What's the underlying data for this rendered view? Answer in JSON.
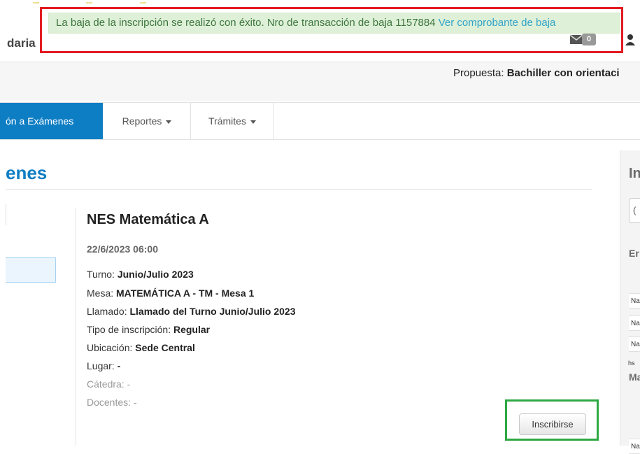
{
  "header": {
    "brand": "daria",
    "mail_count": "0",
    "propuesta_label": "Propuesta:",
    "propuesta_value": "Bachiller con orientaci"
  },
  "nav": {
    "items": [
      {
        "label": "ón a Exámenes",
        "active": true
      },
      {
        "label": "Reportes"
      },
      {
        "label": "Trámites"
      }
    ]
  },
  "main": {
    "page_title": "enes"
  },
  "exam": {
    "title": "NES Matemática A",
    "date": "22/6/2023 06:00",
    "fields": [
      {
        "label": "Turno:",
        "value": "Junio/Julio 2023"
      },
      {
        "label": "Mesa:",
        "value": "MATEMÁTICA A - TM - Mesa 1"
      },
      {
        "label": "Llamado:",
        "value": "Llamado del Turno Junio/Julio 2023"
      },
      {
        "label": "Tipo de inscripción:",
        "value": "Regular"
      },
      {
        "label": "Ubicación:",
        "value": "Sede Central"
      },
      {
        "label": "Lugar:",
        "value": "-"
      },
      {
        "label": "Cátedra:",
        "value": "-"
      },
      {
        "label": "Docentes:",
        "value": "-"
      }
    ],
    "button_label": "Inscribirse"
  },
  "right_panel": {
    "title": "In",
    "box_text": "(",
    "heading_1": "Er",
    "rows": [
      "Na",
      "Na",
      "Na"
    ],
    "hs_text": "hs",
    "heading_2": "Ma",
    "last_row": "Na"
  },
  "alert": {
    "message": "La baja de la inscripción se realizó con éxito. Nro de transacción de baja 1157884",
    "link": "Ver comprobante de baja"
  },
  "top_marks": [
    "scale",
    "scale",
    "scale"
  ],
  "colors": {
    "accent": "#0e7ec4",
    "alert_bg": "#dff0d8",
    "alert_text": "#3c763d",
    "highlight_red": "#e31b23",
    "highlight_green": "#2ea843"
  }
}
